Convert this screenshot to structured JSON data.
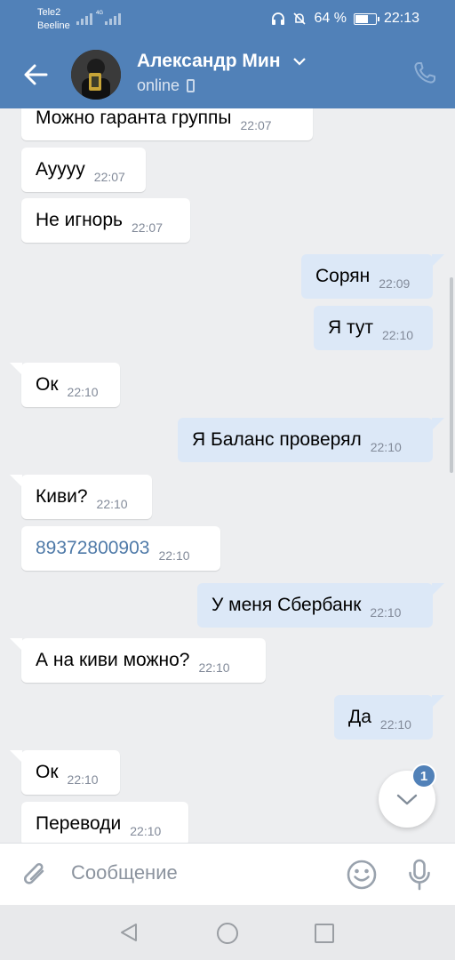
{
  "status_bar": {
    "carrier_1": "Tele2",
    "carrier_2": "Beeline",
    "network": "4G",
    "battery": "64 %",
    "time": "22:13"
  },
  "header": {
    "contact_name": "Александр Мин",
    "presence": "online"
  },
  "messages": [
    {
      "dir": "in",
      "text": "Можно гаранта группы",
      "time": "22:07"
    },
    {
      "dir": "in",
      "text": "Ауууу",
      "time": "22:07"
    },
    {
      "dir": "in",
      "text": "Не игнорь",
      "time": "22:07"
    },
    {
      "dir": "out",
      "text": "Сорян",
      "time": "22:09"
    },
    {
      "dir": "out",
      "text": "Я тут",
      "time": "22:10"
    },
    {
      "dir": "in",
      "text": "Ок",
      "time": "22:10"
    },
    {
      "dir": "out",
      "text": "Я Баланс проверял",
      "time": "22:10"
    },
    {
      "dir": "in",
      "text": "Киви?",
      "time": "22:10"
    },
    {
      "dir": "in",
      "text": "89372800903",
      "time": "22:10"
    },
    {
      "dir": "out",
      "text": "У меня Сбербанк",
      "time": "22:10"
    },
    {
      "dir": "in",
      "text": "А на киви можно?",
      "time": "22:10"
    },
    {
      "dir": "out",
      "text": "Да",
      "time": "22:10"
    },
    {
      "dir": "in",
      "text": "Ок",
      "time": "22:10"
    },
    {
      "dir": "in",
      "text": "Переводи",
      "time": "22:10"
    }
  ],
  "scroll_button": {
    "unread_count": "1"
  },
  "composer": {
    "placeholder": "Сообщение"
  },
  "colors": {
    "header_blue": "#5181b8",
    "outgoing_bubble": "#dce8f7",
    "incoming_bubble": "#ffffff",
    "chat_background": "#edeef0",
    "link": "#4f7aa8"
  }
}
